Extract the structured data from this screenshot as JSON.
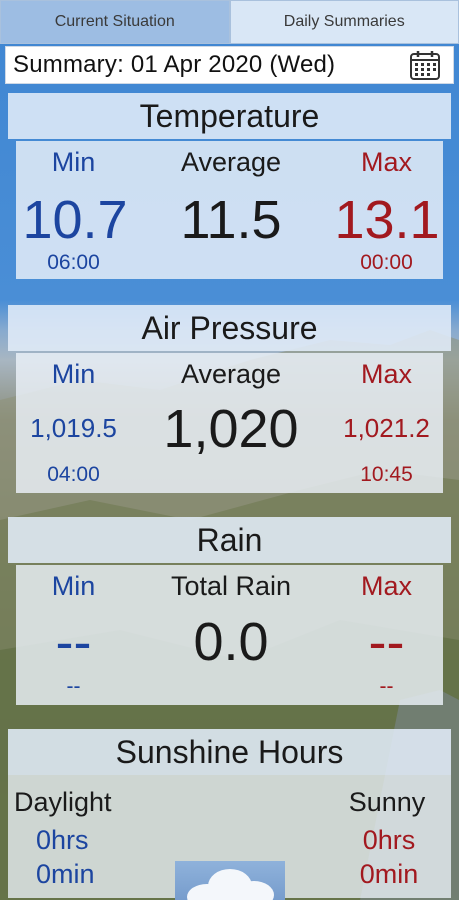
{
  "tabs": [
    {
      "label": "Current Situation",
      "active": true
    },
    {
      "label": "Daily Summaries",
      "active": false
    }
  ],
  "summary": {
    "label": "Summary: 01 Apr 2020  (Wed)"
  },
  "icons": {
    "calendar": "calendar-icon",
    "weather": "cloud-icon"
  },
  "colors": {
    "min": "#1c45a0",
    "max": "#a2191f",
    "title_bg": "#e1ecf8",
    "tab_active": "#9dbde3"
  },
  "temperature": {
    "title": "Temperature",
    "min_label": "Min",
    "avg_label": "Average",
    "max_label": "Max",
    "min": "10.7",
    "avg": "11.5",
    "max": "13.1",
    "min_time": "06:00",
    "max_time": "00:00"
  },
  "pressure": {
    "title": "Air Pressure",
    "min_label": "Min",
    "avg_label": "Average",
    "max_label": "Max",
    "min": "1,019.5",
    "avg": "1,020",
    "max": "1,021.2",
    "min_time": "04:00",
    "max_time": "10:45"
  },
  "rain": {
    "title": "Rain",
    "min_label": "Min",
    "avg_label": "Total Rain",
    "max_label": "Max",
    "min": "--",
    "avg": "0.0",
    "max": "--",
    "min_time": "--",
    "max_time": "--"
  },
  "sunshine": {
    "title": "Sunshine Hours",
    "daylight_label": "Daylight",
    "sunny_label": "Sunny",
    "daylight_hrs": "0hrs",
    "daylight_min": "0min",
    "sunny_hrs": "0hrs",
    "sunny_min": "0min"
  }
}
